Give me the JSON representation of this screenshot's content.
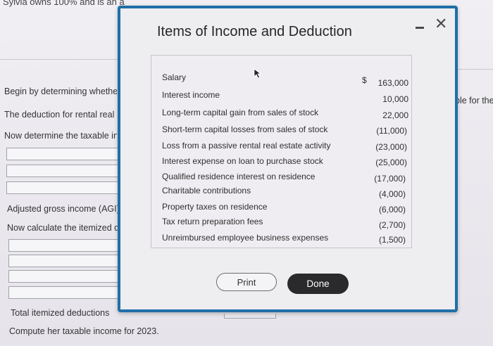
{
  "background": {
    "top_text": "Sylvia owns 100% and is an a",
    "lines": [
      "Begin by determining whethe",
      "The deduction for rental real",
      "Now determine the taxable in",
      "Adjusted gross income (AGI)",
      "Now calculate the itemized de",
      "Total itemized deductions",
      "Compute her taxable income for 2023."
    ],
    "right_text": "ble for the"
  },
  "modal": {
    "title": "Items of Income and Deduction",
    "minimize_label": "",
    "close_label": "✕",
    "currency_symbol": "$",
    "rows": [
      {
        "label": "Salary",
        "value": "163,000"
      },
      {
        "label": "Interest income",
        "value": "10,000"
      },
      {
        "label": "Long-term capital gain from sales of stock",
        "value": "22,000"
      },
      {
        "label": "Short-term capital losses from sales of stock",
        "value": "(11,000)"
      },
      {
        "label": "Loss from a passive rental real estate activity",
        "value": "(23,000)"
      },
      {
        "label": "Interest expense on loan to purchase stock",
        "value": "(25,000)"
      },
      {
        "label": "Qualified residence interest on residence",
        "value": "(17,000)"
      },
      {
        "label": "Charitable contributions",
        "value": "(4,000)"
      },
      {
        "label": "Property taxes on residence",
        "value": "(6,000)"
      },
      {
        "label": "Tax return preparation fees",
        "value": "(2,700)"
      },
      {
        "label": "Unreimbursed employee business expenses",
        "value": "(1,500)"
      }
    ],
    "print_label": "Print",
    "done_label": "Done"
  }
}
